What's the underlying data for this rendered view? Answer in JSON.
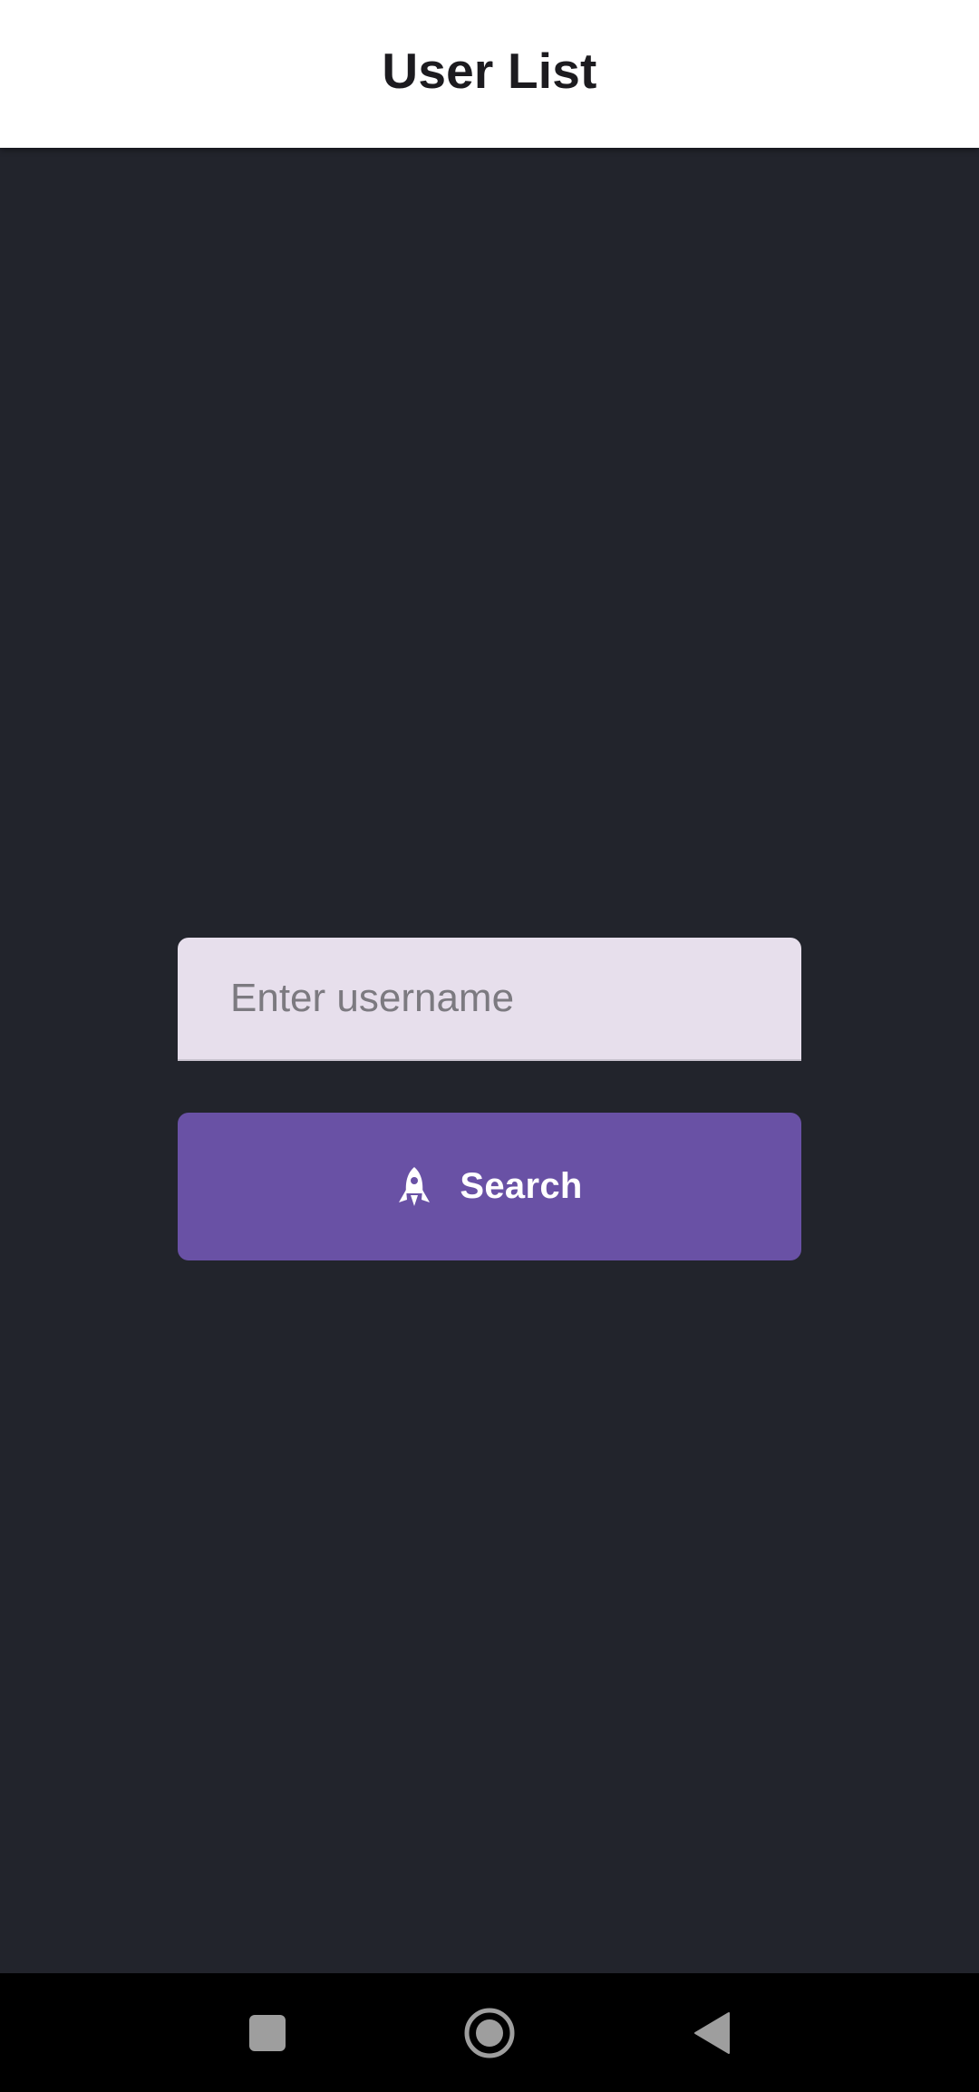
{
  "app_bar": {
    "title": "User List"
  },
  "username_field": {
    "value": "",
    "placeholder": "Enter username"
  },
  "search_button": {
    "label": "Search",
    "icon": "rocket-icon"
  },
  "nav_bar": {
    "recents_icon": "square-icon",
    "home_icon": "circle-icon",
    "back_icon": "triangle-back-icon"
  },
  "colors": {
    "background": "#22242c",
    "app_bar": "#ffffff",
    "field_background": "#e7dfec",
    "button": "#6951a5",
    "nav_bar": "#000000"
  }
}
